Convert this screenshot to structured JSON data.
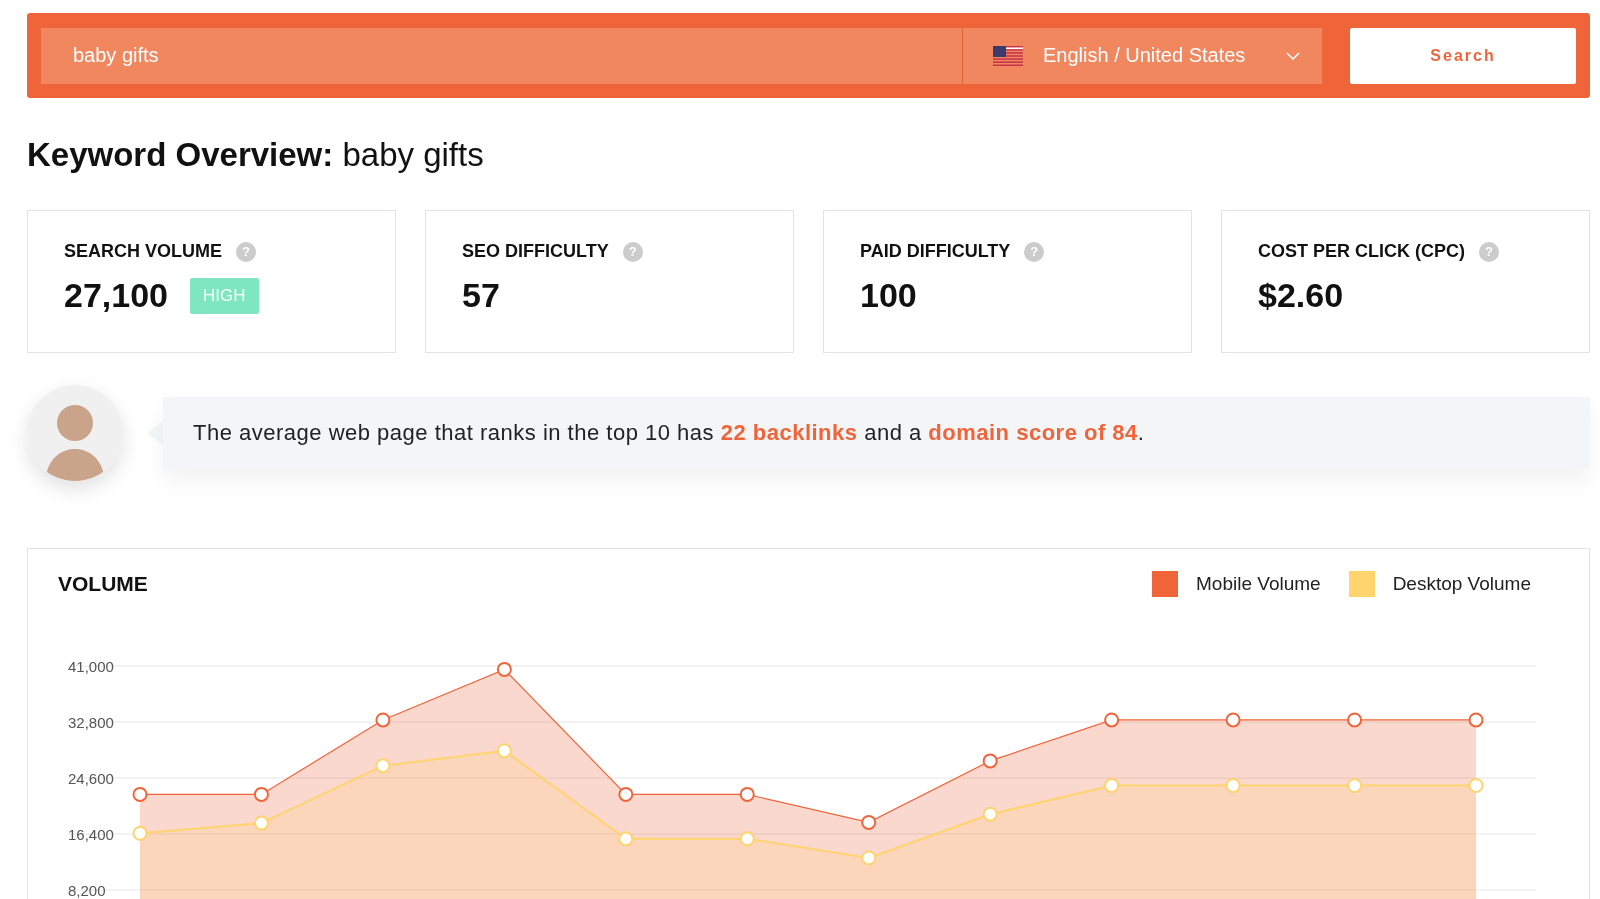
{
  "search_bar": {
    "query": "baby gifts",
    "locale": "English / United States",
    "button": "Search"
  },
  "heading": {
    "label": "Keyword Overview:",
    "keyword": "baby gifts"
  },
  "metrics": [
    {
      "label": "SEARCH VOLUME",
      "help": "?",
      "value": "27,100",
      "badge": "HIGH"
    },
    {
      "label": "SEO DIFFICULTY",
      "help": "?",
      "value": "57"
    },
    {
      "label": "PAID DIFFICULTY",
      "help": "?",
      "value": "100"
    },
    {
      "label": "COST PER CLICK (CPC)",
      "help": "?",
      "value": "$2.60"
    }
  ],
  "insight": {
    "text": "The average web page that ranks in the top 10 has **22 backlinks** and a **domain score of 84**."
  },
  "volume": {
    "title": "VOLUME",
    "chart_data": {
      "type": "area",
      "grid": true,
      "yticks": [
        {
          "value": 8200,
          "label": "8,200"
        },
        {
          "value": 16400,
          "label": "16,400"
        },
        {
          "value": 24600,
          "label": "24,600"
        },
        {
          "value": 32800,
          "label": "32,800"
        },
        {
          "value": 41000,
          "label": "41,000"
        }
      ],
      "ylim": [
        0,
        41000
      ],
      "series": [
        {
          "name": "Mobile Volume",
          "color": "#f0643a",
          "values": [
            22200,
            22200,
            33100,
            40500,
            22200,
            22200,
            18100,
            27100,
            33100,
            33100,
            33100,
            33100
          ]
        },
        {
          "name": "Desktop Volume",
          "color": "#ffd36e",
          "values": [
            16500,
            18000,
            26400,
            28600,
            15700,
            15700,
            12900,
            19300,
            23500,
            23500,
            23500,
            23500
          ]
        }
      ]
    }
  }
}
